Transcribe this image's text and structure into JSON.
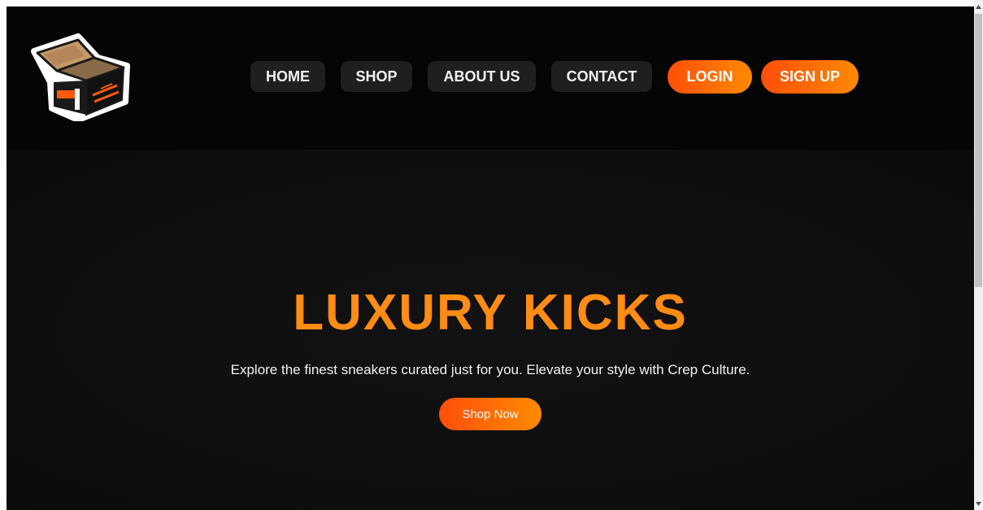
{
  "nav": {
    "items": [
      {
        "label": "HOME"
      },
      {
        "label": "SHOP"
      },
      {
        "label": "ABOUT US"
      },
      {
        "label": "CONTACT"
      }
    ],
    "login_label": "LOGIN",
    "signup_label": "SIGN UP"
  },
  "logo": {
    "icon": "shoebox-logo-icon"
  },
  "hero": {
    "title": "LUXURY KICKS",
    "subtitle": "Explore the finest sneakers curated just for you. Elevate your style with Crep Culture.",
    "cta_label": "Shop Now"
  },
  "colors": {
    "accent_start": "#ff4e0a",
    "accent_end": "#ff8a00",
    "title": "#ff8c14",
    "header_bg": "#050505",
    "hero_bg": "#0f0f0f",
    "nav_button_bg": "#1f1f1f"
  }
}
